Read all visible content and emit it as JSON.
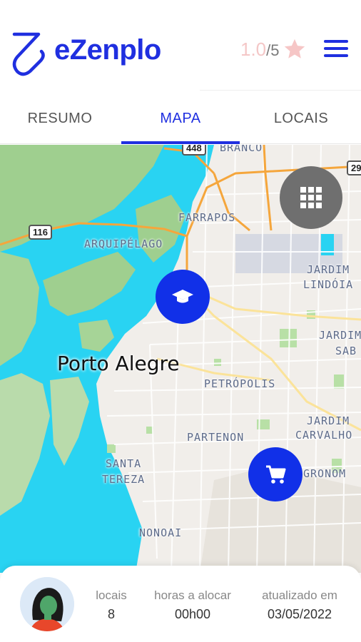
{
  "app": {
    "name": "eZenplo",
    "rating_value": "1.0",
    "rating_suffix": "/5",
    "accent_color": "#1f2fe0"
  },
  "tabs": [
    {
      "label": "RESUMO",
      "active": false
    },
    {
      "label": "MAPA",
      "active": true
    },
    {
      "label": "LOCAIS",
      "active": false
    }
  ],
  "map": {
    "city": "Porto Alegre",
    "labels": {
      "branco": "BRANCO",
      "farrapos": "FARRAPOS",
      "arquipelago": "ARQUIPÉLAGO",
      "jardim_lindoia_1": "JARDIM",
      "jardim_lindoia_2": "LINDÓIA",
      "jardim_sab_1": "JARDIM",
      "jardim_sab_2": "SAB",
      "petropolis": "PETRÓPOLIS",
      "jardim_carvalho_1": "JARDIM",
      "jardim_carvalho_2": "CARVALHO",
      "partenon": "PARTENON",
      "agronom": "GRONOM",
      "santa_tereza_1": "SANTA",
      "santa_tereza_2": "TEREZA",
      "nonoai": "NONOAI"
    },
    "shields": {
      "r116": "116",
      "r448": "448",
      "r290": "29"
    },
    "water_color": "#29d3f2",
    "land_color": "#f1eeea",
    "green_color": "#9fcf8f",
    "pins": [
      {
        "icon": "graduation-cap-icon"
      },
      {
        "icon": "shopping-cart-icon"
      }
    ]
  },
  "summary": {
    "locais_label": "locais",
    "locais_value": "8",
    "horas_label": "horas a alocar",
    "horas_value": "00h00",
    "atualizado_label": "atualizado em",
    "atualizado_value": "03/05/2022"
  }
}
